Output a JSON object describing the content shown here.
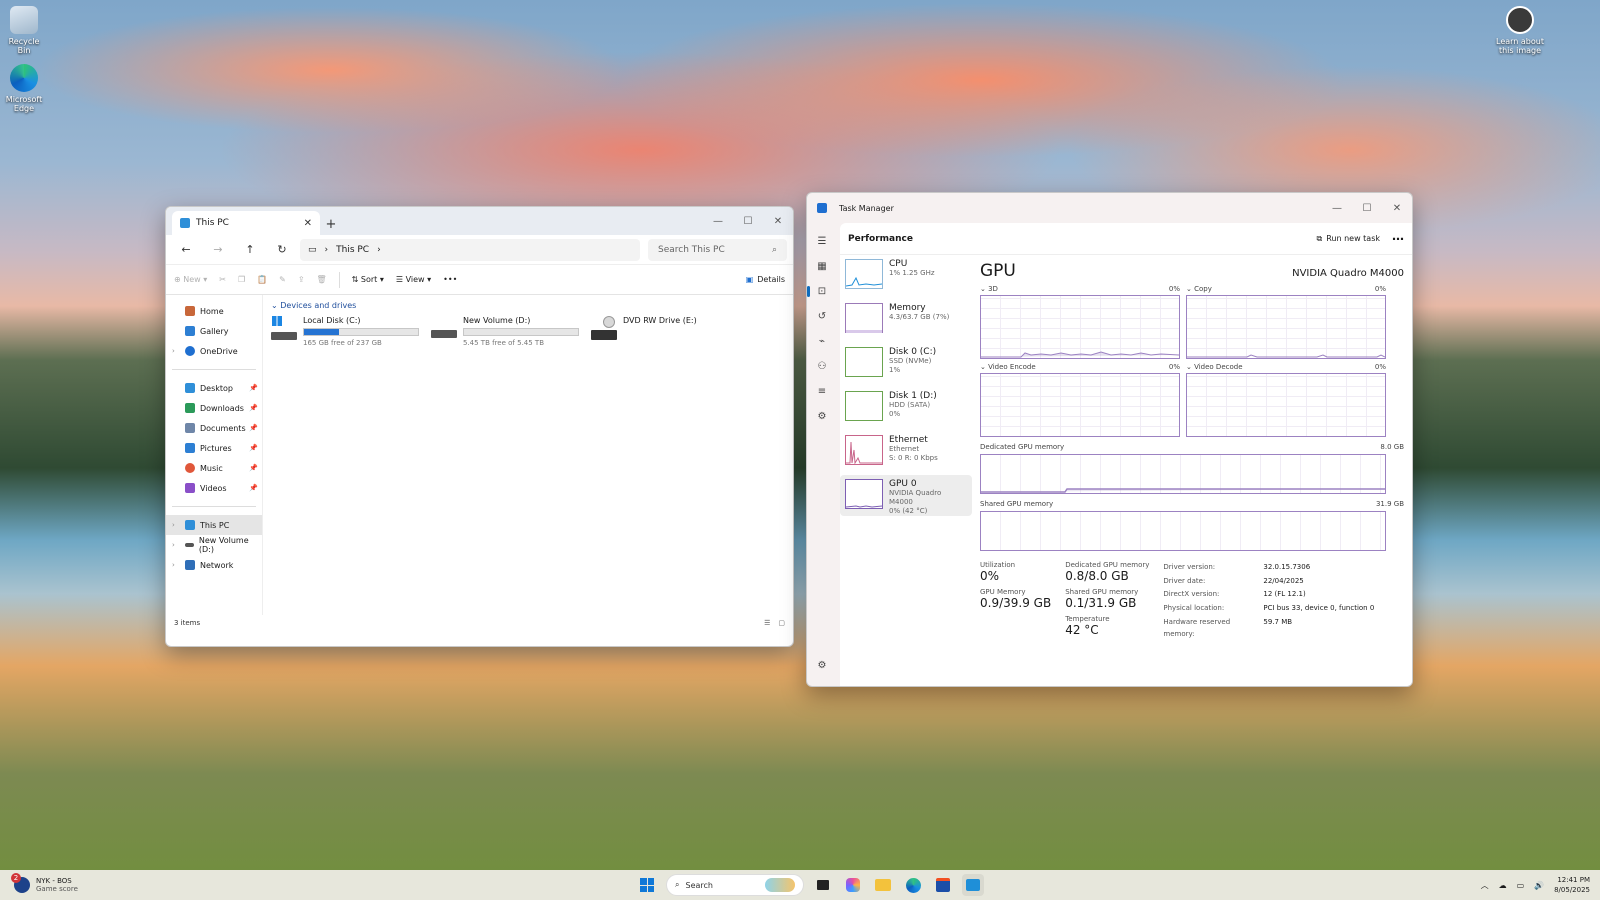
{
  "desktop": {
    "icons": [
      {
        "label": "Recycle Bin"
      },
      {
        "label": "Microsoft Edge"
      }
    ],
    "learn_label": "Learn about this image"
  },
  "explorer": {
    "tab_title": "This PC",
    "path": [
      "This PC"
    ],
    "search_placeholder": "Search This PC",
    "commands": {
      "new": "New",
      "sort": "Sort",
      "view": "View",
      "more": "•••",
      "details": "Details"
    },
    "sidebar": {
      "top": [
        {
          "label": "Home",
          "icon": "home-icon",
          "color": "#c8673a"
        },
        {
          "label": "Gallery",
          "icon": "gallery-icon",
          "color": "#2d7fd3"
        },
        {
          "label": "OneDrive",
          "icon": "cloud-icon",
          "color": "#1f6fd0"
        }
      ],
      "pinned": [
        {
          "label": "Desktop",
          "icon": "desktop-icon",
          "color": "#2f8fd8"
        },
        {
          "label": "Downloads",
          "icon": "download-icon",
          "color": "#2b9a5a"
        },
        {
          "label": "Documents",
          "icon": "documents-icon",
          "color": "#6f86a8"
        },
        {
          "label": "Pictures",
          "icon": "pictures-icon",
          "color": "#2d7fd3"
        },
        {
          "label": "Music",
          "icon": "music-icon",
          "color": "#e0573a"
        },
        {
          "label": "Videos",
          "icon": "videos-icon",
          "color": "#8a4fc8"
        }
      ],
      "tree": [
        {
          "label": "This PC",
          "icon": "computer-icon",
          "color": "#2f8fd8"
        },
        {
          "label": "New Volume (D:)",
          "icon": "drive-icon",
          "color": "#555555"
        },
        {
          "label": "Network",
          "icon": "network-icon",
          "color": "#2f6fb8"
        }
      ]
    },
    "group_label": "Devices and drives",
    "drives": [
      {
        "name": "Local Disk (C:)",
        "free": "165 GB free of 237 GB",
        "used_fraction": 0.304
      },
      {
        "name": "New Volume (D:)",
        "free": "5.45 TB free of 5.45 TB",
        "used_fraction": 0.0
      },
      {
        "name": "DVD RW Drive (E:)"
      }
    ],
    "status": "3 items"
  },
  "taskmanager": {
    "title": "Task Manager",
    "section": "Performance",
    "run_new_task": "Run new task",
    "list": [
      {
        "name": "CPU",
        "sub1": "1% 1.25 GHz"
      },
      {
        "name": "Memory",
        "sub1": "4.3/63.7 GB (7%)"
      },
      {
        "name": "Disk 0 (C:)",
        "sub1": "SSD (NVMe)",
        "sub2": "1%"
      },
      {
        "name": "Disk 1 (D:)",
        "sub1": "HDD (SATA)",
        "sub2": "0%"
      },
      {
        "name": "Ethernet",
        "sub1": "Ethernet",
        "sub2": "S: 0 R: 0 Kbps"
      },
      {
        "name": "GPU 0",
        "sub1": "NVIDIA Quadro M4000",
        "sub2": "0% (42 °C)"
      }
    ],
    "gpu": {
      "heading": "GPU",
      "model": "NVIDIA Quadro M4000",
      "graphs": [
        {
          "label": "3D",
          "pct": "0%"
        },
        {
          "label": "Copy",
          "pct": "0%"
        },
        {
          "label": "Video Encode",
          "pct": "0%"
        },
        {
          "label": "Video Decode",
          "pct": "0%"
        }
      ],
      "dedicated_label": "Dedicated GPU memory",
      "dedicated_max": "8.0 GB",
      "shared_label": "Shared GPU memory",
      "shared_max": "31.9 GB",
      "stats": {
        "utilization_label": "Utilization",
        "utilization": "0%",
        "dedicated_label": "Dedicated GPU memory",
        "dedicated": "0.8/8.0 GB",
        "gpu_memory_label": "GPU Memory",
        "gpu_memory": "0.9/39.9 GB",
        "shared_label": "Shared GPU memory",
        "shared": "0.1/31.9 GB",
        "temp_label": "Temperature",
        "temp": "42 °C"
      },
      "details": [
        {
          "k": "Driver version:",
          "v": "32.0.15.7306"
        },
        {
          "k": "Driver date:",
          "v": "22/04/2025"
        },
        {
          "k": "DirectX version:",
          "v": "12 (FL 12.1)"
        },
        {
          "k": "Physical location:",
          "v": "PCI bus 33, device 0, function 0"
        },
        {
          "k": "Hardware reserved memory:",
          "v": "59.7 MB"
        }
      ]
    }
  },
  "taskbar": {
    "widget_title": "NYK - BOS",
    "widget_sub": "Game score",
    "widget_badge": "2",
    "search_label": "Search",
    "time": "12:41 PM",
    "date": "8/05/2025"
  }
}
